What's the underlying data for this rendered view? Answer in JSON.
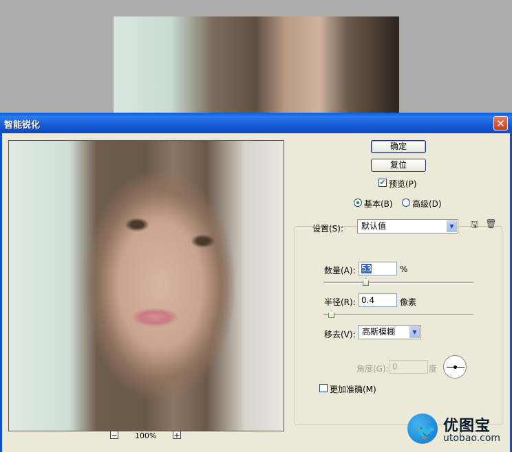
{
  "dialog": {
    "title": "智能锐化",
    "close_glyph": "✕"
  },
  "buttons": {
    "ok": "确定",
    "reset": "复位"
  },
  "preview": {
    "label": "预览(P)",
    "checked": true
  },
  "mode": {
    "basic": "基本(B)",
    "advanced": "高级(D)",
    "selected": "basic"
  },
  "settings": {
    "label": "设置(S):",
    "value": "默认值"
  },
  "amount": {
    "label": "数量(A):",
    "value": "53",
    "unit": "%",
    "level": 53
  },
  "radius": {
    "label": "半径(R):",
    "value": "0.4",
    "unit": "像素",
    "level": 0.4
  },
  "remove": {
    "label": "移去(V):",
    "value": "高斯模糊"
  },
  "angle": {
    "label": "角度(G):",
    "value": "0",
    "unit": "度"
  },
  "more_accurate": {
    "label": "更加准确(M)",
    "checked": false
  },
  "zoom": {
    "minus": "−",
    "plus": "+",
    "level": "100%"
  },
  "watermark": {
    "title": "优图宝",
    "url": "utobao.com"
  }
}
